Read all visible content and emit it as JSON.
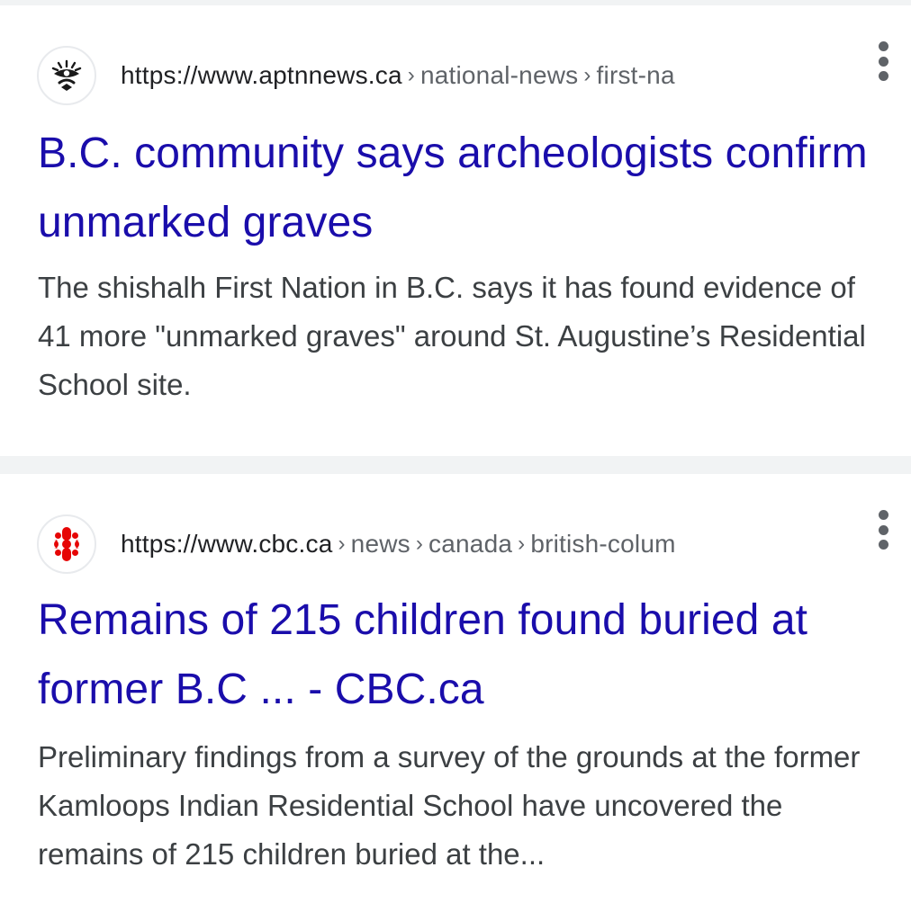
{
  "results": [
    {
      "domain": "https://www.aptnnews.ca",
      "breadcrumbs": [
        "national-news",
        "first-na"
      ],
      "favicon": "aptn-logo-icon",
      "title": "B.C. community says archeologists confirm unmarked graves",
      "snippet": "The shishalh First Nation in B.C. says it has found evidence of 41 more \"unmarked graves\" around St. Augustine’s Residential School site."
    },
    {
      "domain": "https://www.cbc.ca",
      "breadcrumbs": [
        "news",
        "canada",
        "british-colum"
      ],
      "favicon": "cbc-gem-logo-icon",
      "title": "Remains of 215 children found buried at former B.C ... - CBC.ca",
      "snippet": "Preliminary findings from a survey of the grounds at the former Kamloops Indian Residential School have uncovered the remains of 215 children buried at the..."
    }
  ],
  "colors": {
    "title_link": "#1a0dab",
    "url_text": "#202124",
    "breadcrumb_text": "#5f6368",
    "snippet_text": "#3c4043",
    "divider": "#f1f3f4",
    "cbc_red": "#e60505"
  },
  "icons": {
    "more": "more-vert-icon"
  }
}
